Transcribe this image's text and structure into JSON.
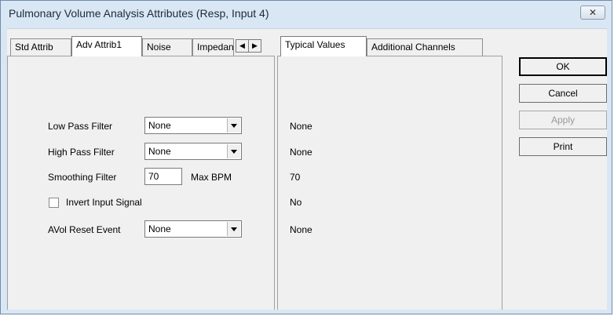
{
  "window": {
    "title": "Pulmonary Volume Analysis Attributes  (Resp, Input 4)",
    "close_glyph": "✕"
  },
  "left_tabs": [
    "Std Attrib",
    "Adv Attrib1",
    "Noise",
    "Impedance"
  ],
  "left_tabs_active": "Adv Attrib1",
  "right_tabs": [
    "Typical Values",
    "Additional Channels"
  ],
  "right_tabs_active": "Typical Values",
  "form": {
    "low_pass": {
      "label": "Low Pass Filter",
      "value": "None"
    },
    "high_pass": {
      "label": "High Pass Filter",
      "value": "None"
    },
    "smoothing": {
      "label": "Smoothing Filter",
      "value": "70",
      "unit": "Max BPM"
    },
    "invert": {
      "label": "Invert Input Signal",
      "checked": false
    },
    "avol_reset": {
      "label": "AVol Reset Event",
      "value": "None"
    }
  },
  "typical": {
    "low_pass": "None",
    "high_pass": "None",
    "smoothing": "70",
    "invert": "No",
    "avol_reset": "None"
  },
  "buttons": {
    "ok": "OK",
    "cancel": "Cancel",
    "apply": "Apply",
    "print": "Print"
  },
  "icons": {
    "scroll_left": "◀",
    "scroll_right": "▶"
  }
}
